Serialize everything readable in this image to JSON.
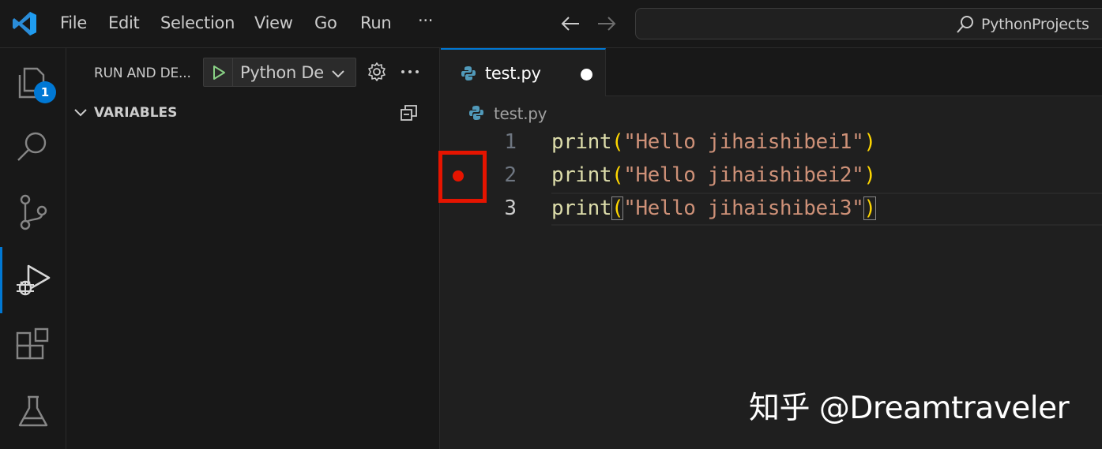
{
  "titlebar": {
    "menu": [
      "File",
      "Edit",
      "Selection",
      "View",
      "Go",
      "Run",
      "···"
    ],
    "command_center_label": "PythonProjects"
  },
  "activity_bar": {
    "explorer_badge": "1"
  },
  "sidebar": {
    "title": "RUN AND DE...",
    "launch_config_label": "Python De",
    "section_title": "VARIABLES"
  },
  "editor": {
    "tab_label": "test.py",
    "breadcrumb": "test.py",
    "line_numbers": [
      "1",
      "2",
      "3"
    ],
    "lines": [
      {
        "fn": "print",
        "open": "(",
        "str": "\"Hello jihaishibei1\"",
        "close": ")"
      },
      {
        "fn": "print",
        "open": "(",
        "str": "\"Hello jihaishibei2\"",
        "close": ")"
      },
      {
        "fn": "print",
        "open": "(",
        "str": "\"Hello jihaishibei3\"",
        "close": ")"
      }
    ]
  },
  "watermark": "知乎 @Dreamtraveler",
  "colors": {
    "accent": "#0078d4",
    "breakpoint": "#e51400",
    "function": "#dcdcaa",
    "string": "#ce9178",
    "bracket": "#ffd700"
  },
  "icons": {
    "activity": [
      "files-icon",
      "search-icon",
      "source-control-icon",
      "run-debug-icon",
      "extensions-icon",
      "testing-icon"
    ]
  }
}
